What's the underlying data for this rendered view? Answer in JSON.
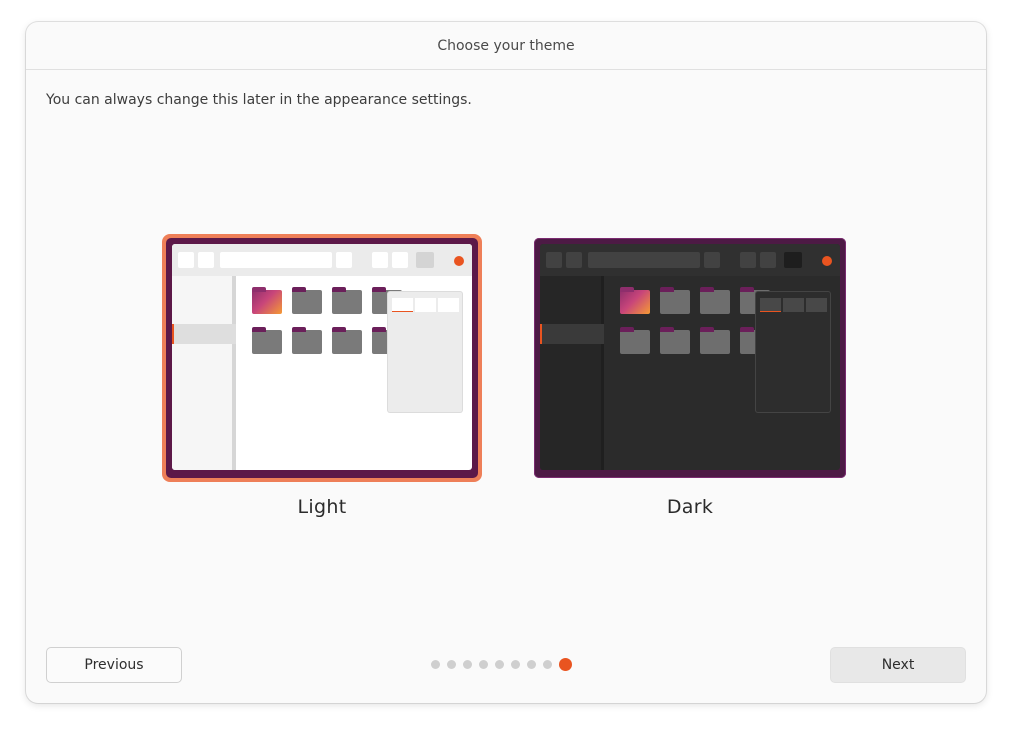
{
  "window": {
    "title": "Choose your theme",
    "subtitle": "You can always change this later in the appearance settings."
  },
  "themes": [
    {
      "label": "Light",
      "selected": true
    },
    {
      "label": "Dark",
      "selected": false
    }
  ],
  "navigation": {
    "previous_label": "Previous",
    "next_label": "Next",
    "total_steps": 9,
    "current_step": 9
  },
  "colors": {
    "accent": "#e95420",
    "selection_border": "#ee7f58",
    "preview_wallpaper": "#5c1848"
  }
}
